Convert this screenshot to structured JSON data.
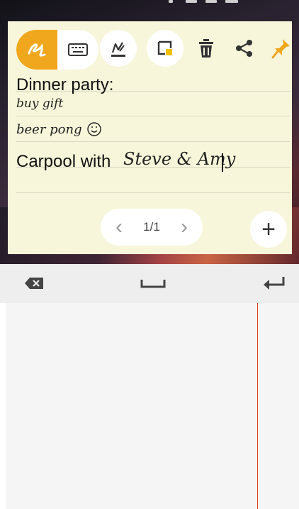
{
  "note": {
    "toolbar": {
      "handwriting_mode": "handwriting-mode-icon",
      "keyboard_mode": "keyboard-icon",
      "pen": "pen-color-icon",
      "background": "note-background-icon",
      "delete": "trash-icon",
      "share": "share-icon",
      "pin": "pin-icon",
      "accent": "#f0a71d"
    },
    "lines": {
      "line1": "Dinner party:",
      "line2": "buy gift",
      "line3": "beer pong",
      "line4_typed": "Carpool with",
      "line4_hand": "Steve & Amy"
    },
    "pager": {
      "prev": "‹",
      "count": "1/1",
      "next": "›"
    },
    "add": "+"
  },
  "keyboard": {
    "backspace": "backspace-icon",
    "space": "space-icon",
    "enter": "enter-icon",
    "cursor_color": "#e04010"
  }
}
